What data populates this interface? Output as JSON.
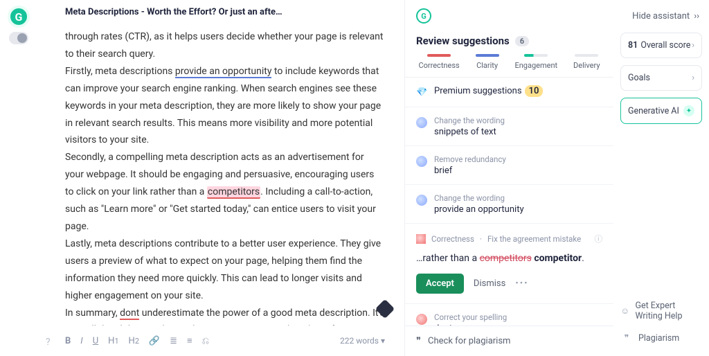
{
  "doc_title": "Meta Descriptions - Worth the Effort? Or just an afte…",
  "paragraphs": {
    "p1a": "through rates (CTR), as it helps users decide whether your page is relevant to their search query.",
    "p2a": "Firstly, meta descriptions ",
    "p2_underline": "provide an opportunity",
    "p2b": " to include keywords that can improve your search engine ranking. When search engines see these keywords in your meta description, they are more likely to show your page in relevant search results. This means more visibility and more potential visitors to your site.",
    "p3a": "Secondly, a compelling meta description acts as an advertisement for your webpage. It should be engaging and persuasive, encouraging users to click on your link rather than a ",
    "p3_hl": "competitors",
    "p3b": ". Including a call-to-action, such as \"Learn more\" or \"Get started today,\" can entice users to visit your page.",
    "p4": "Lastly, meta descriptions contribute to a better user experience. They give users a preview of what to expect on your page, helping them find the information they need more quickly. This can lead to longer visits and higher engagement on your site.",
    "p5a": "In summary, ",
    "p5_ul": "dont",
    "p5b": " underestimate the power of a good meta description. It's a small detail that can have a big impact on your website's performance."
  },
  "toolbar": {
    "words": "222 words"
  },
  "review": {
    "title": "Review suggestions",
    "count": "6",
    "tabs": [
      "Correctness",
      "Clarity",
      "Engagement",
      "Delivery"
    ],
    "premium_label": "Premium suggestions",
    "premium_count": "10",
    "items": [
      {
        "hint": "Change the wording",
        "text": "snippets of text"
      },
      {
        "hint": "Remove redundancy",
        "text": "brief"
      },
      {
        "hint": "Change the wording",
        "text": "provide an opportunity"
      }
    ],
    "card": {
      "cat": "Correctness",
      "rule": "Fix the agreement mistake",
      "pre": "…rather than a ",
      "wrong": "competitors",
      "right": " competitor",
      "post": ".",
      "accept": "Accept",
      "dismiss": "Dismiss"
    },
    "spelling": {
      "hint": "Correct your spelling",
      "text": "dont"
    },
    "plagiarism": "Check for plagiarism"
  },
  "side": {
    "hide": "Hide assistant",
    "score_num": "81",
    "score_label": "Overall score",
    "goals": "Goals",
    "genai": "Generative AI",
    "expert": "Get Expert Writing Help",
    "plag": "Plagiarism"
  }
}
